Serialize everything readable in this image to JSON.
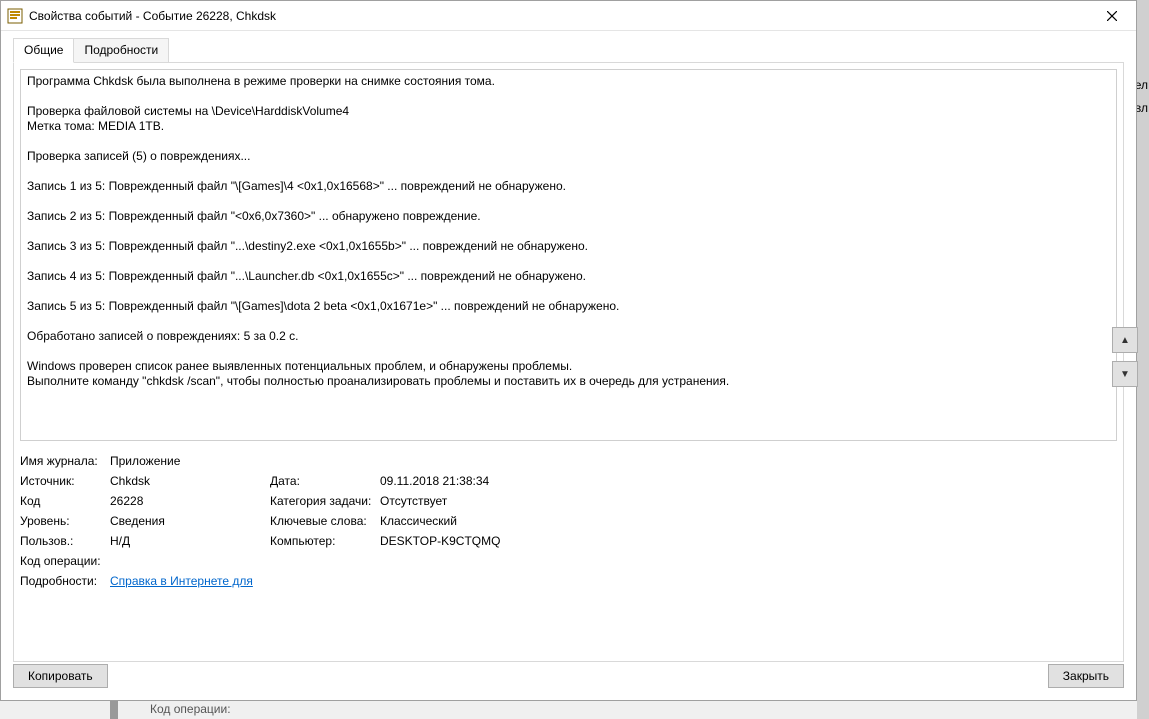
{
  "window": {
    "title": "Свойства событий - Событие 26228, Chkdsk"
  },
  "tabs": {
    "general": "Общие",
    "details": "Подробности"
  },
  "description": {
    "p1": [
      "Программа Chkdsk была выполнена в режиме проверки на снимке состояния тома."
    ],
    "p2": [
      "Проверка файловой системы на \\Device\\HarddiskVolume4",
      "Метка тома: MEDIA 1TB."
    ],
    "p3": [
      "Проверка записей (5) о повреждениях..."
    ],
    "p4": [
      "Запись 1 из 5: Поврежденный файл \"\\[Games]\\4 <0x1,0x16568>\" ... повреждений не обнаружено."
    ],
    "p5": [
      "Запись 2 из 5: Поврежденный файл \"<0x6,0x7360>\" ... обнаружено повреждение."
    ],
    "p6": [
      "Запись 3 из 5: Поврежденный файл \"...\\destiny2.exe <0x1,0x1655b>\" ... повреждений не обнаружено."
    ],
    "p7": [
      "Запись 4 из 5: Поврежденный файл \"...\\Launcher.db <0x1,0x1655c>\" ... повреждений не обнаружено."
    ],
    "p8": [
      "Запись 5 из 5: Поврежденный файл \"\\[Games]\\dota 2 beta <0x1,0x1671e>\" ... повреждений не обнаружено."
    ],
    "p9": [
      "Обработано записей о повреждениях: 5 за 0.2 с."
    ],
    "p10": [
      "Windows проверен список ранее выявленных потенциальных проблем, и обнаружены проблемы.",
      "Выполните команду \"chkdsk /scan\", чтобы полностью проанализировать проблемы и поставить их в очередь для устранения."
    ]
  },
  "meta": {
    "log_label": "Имя журнала:",
    "log_value": "Приложение",
    "source_label": "Источник:",
    "source_value": "Chkdsk",
    "date_label": "Дата:",
    "date_value": "09.11.2018 21:38:34",
    "eventid_label": "Код",
    "eventid_value": "26228",
    "category_label": "Категория задачи:",
    "category_value": "Отсутствует",
    "level_label": "Уровень:",
    "level_value": "Сведения",
    "keywords_label": "Ключевые слова:",
    "keywords_value": "Классический",
    "user_label": "Пользов.:",
    "user_value": "Н/Д",
    "computer_label": "Компьютер:",
    "computer_value": "DESKTOP-K9CTQMQ",
    "opcode_label": "Код операции:",
    "opcode_value": "",
    "moreinfo_label": "Подробности:",
    "moreinfo_link": "Справка в Интернете для "
  },
  "buttons": {
    "copy": "Копировать",
    "close": "Закрыть"
  },
  "nav": {
    "up": "▲",
    "down": "▼"
  },
  "background": {
    "opcode_label": "Код операции:",
    "side_text1": "ел",
    "side_text2": "вл"
  }
}
